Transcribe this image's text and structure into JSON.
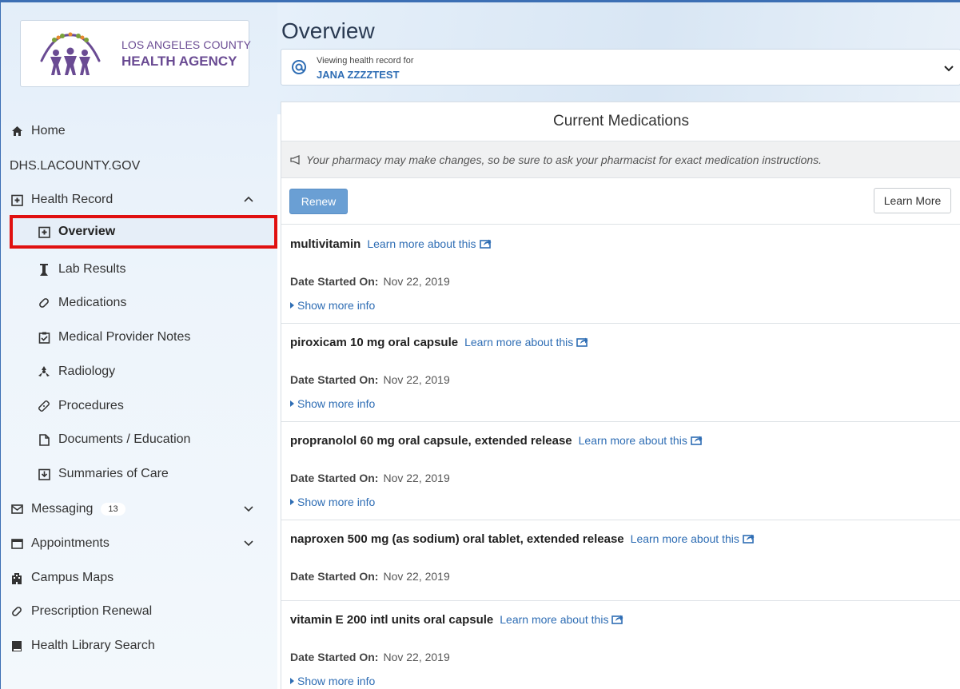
{
  "logo": {
    "line1": "LOS ANGELES COUNTY",
    "line2": "HEALTH AGENCY"
  },
  "nav": {
    "home": "Home",
    "site": "DHS.LACOUNTY.GOV",
    "health_record": "Health Record",
    "overview": "Overview",
    "lab_results": "Lab Results",
    "medications": "Medications",
    "provider_notes": "Medical Provider Notes",
    "radiology": "Radiology",
    "procedures": "Procedures",
    "documents": "Documents / Education",
    "summaries": "Summaries of Care",
    "messaging": "Messaging",
    "messaging_count": "13",
    "appointments": "Appointments",
    "campus_maps": "Campus Maps",
    "prescription_renewal": "Prescription Renewal",
    "library": "Health Library Search"
  },
  "page": {
    "title": "Overview",
    "viewing_label": "Viewing health record for",
    "patient_name": "JANA ZZZZTEST"
  },
  "card": {
    "title": "Current Medications",
    "notice": "Your pharmacy may make changes, so be sure to ask your pharmacist for exact medication instructions.",
    "renew_label": "Renew",
    "learn_more_label": "Learn More"
  },
  "medications": [
    {
      "name": "multivitamin",
      "link": "Learn more about this",
      "date_label": "Date Started On:",
      "date": "Nov 22, 2019",
      "more": "Show more info"
    },
    {
      "name": "piroxicam 10 mg oral capsule",
      "link": "Learn more about this",
      "date_label": "Date Started On:",
      "date": "Nov 22, 2019",
      "more": "Show more info"
    },
    {
      "name": "propranolol 60 mg oral capsule, extended release",
      "link": "Learn more about this",
      "date_label": "Date Started On:",
      "date": "Nov 22, 2019",
      "more": "Show more info"
    },
    {
      "name": "naproxen 500 mg (as sodium) oral tablet, extended release",
      "link": "Learn more about this",
      "date_label": "Date Started On:",
      "date": "Nov 22, 2019"
    },
    {
      "name": "vitamin E 200 intl units oral capsule",
      "link": "Learn more about this",
      "date_label": "Date Started On:",
      "date": "Nov 22, 2019",
      "more": "Show more info"
    }
  ],
  "colors": {
    "accent": "#2e6db4",
    "highlight": "#e01010",
    "renew_button": "#6a9fd4",
    "logo_purple": "#6a4b93"
  }
}
